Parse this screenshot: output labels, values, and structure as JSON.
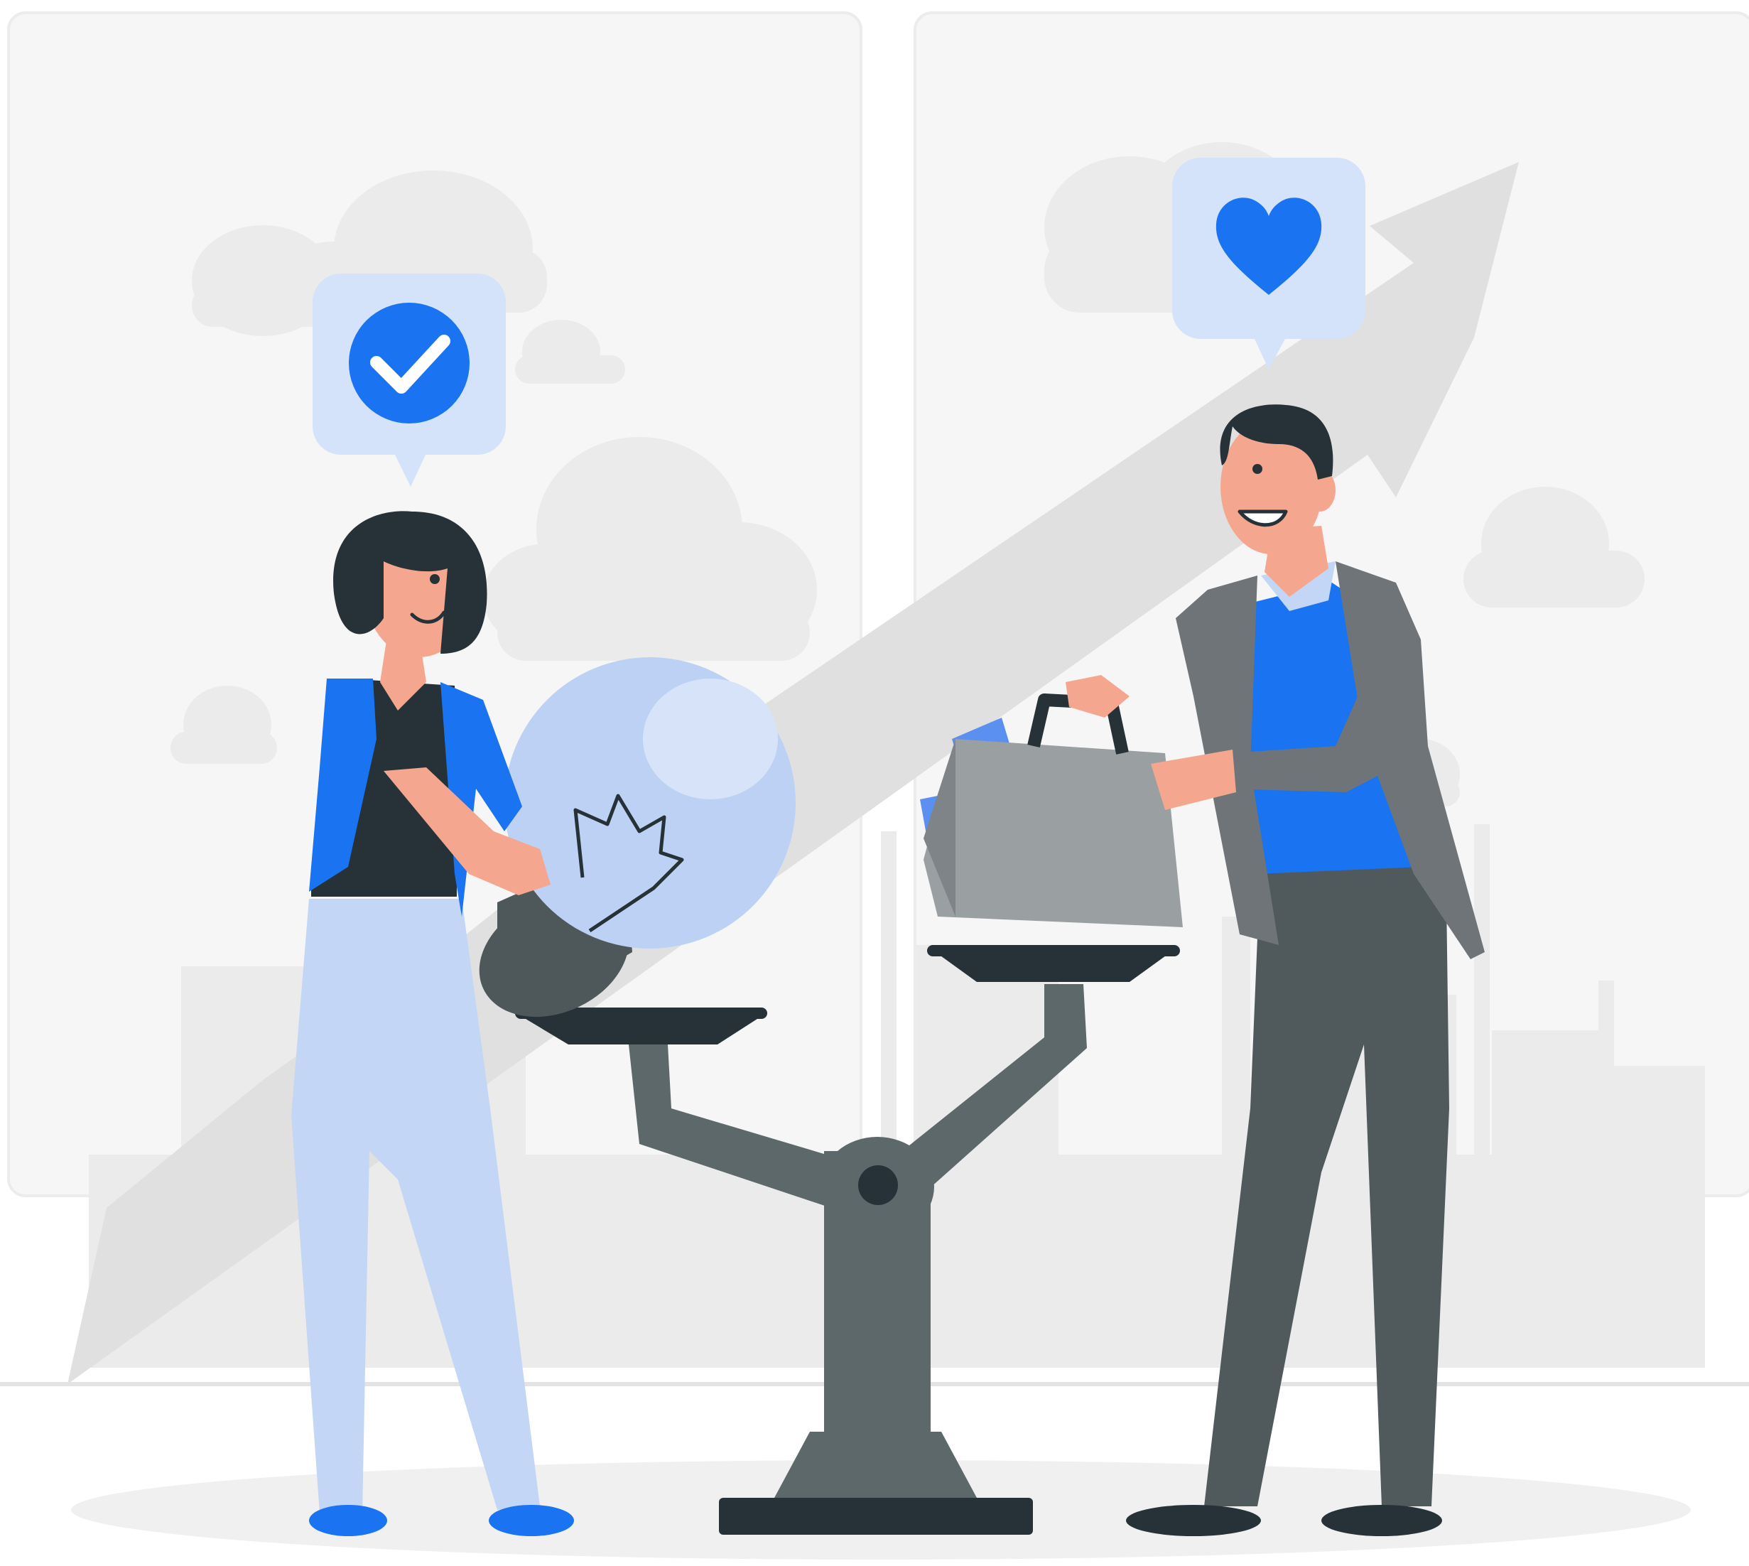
{
  "scene": {
    "colors": {
      "background": "#ffffff",
      "panel": "#f6f6f6",
      "panel_border": "#ececec",
      "cloud": "#ebebeb",
      "skyline": "#ebebeb",
      "arrow": "#e0e0e0",
      "ground": "#f0f0f0",
      "floor_line": "#e3e3e3",
      "accent_blue": "#1a73f0",
      "light_blue": "#c3d6f5",
      "bubble_bg": "#d5e3fa",
      "bulb_glass": "#bcd1f3",
      "bulb_base": "#4e5759",
      "dark": "#263238",
      "hair": "#263238",
      "skin": "#f4a78e",
      "suit": "#6f7478",
      "trousers": "#505a5d",
      "briefcase": "#9a9fa2",
      "scale_body": "#5d686b",
      "money": "#5b8ff0"
    },
    "icons": {
      "left_bubble": "check-icon",
      "right_bubble": "heart-icon"
    }
  }
}
